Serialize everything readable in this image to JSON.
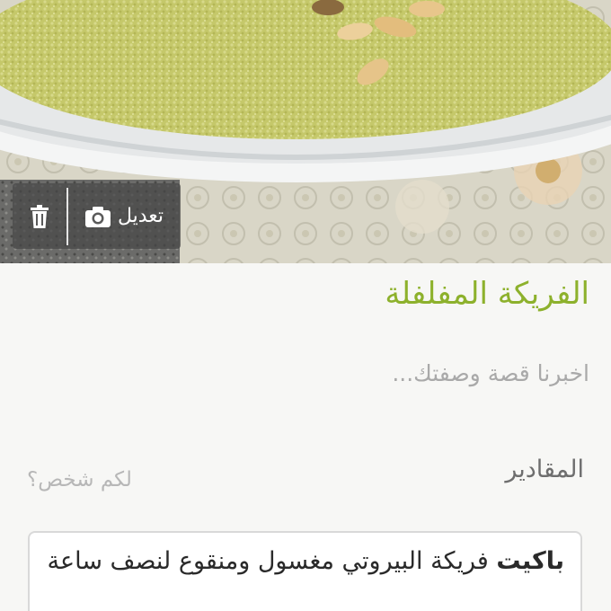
{
  "photo_toolbar": {
    "edit_label": "تعديل",
    "edit_icon": "camera-icon",
    "delete_icon": "trash-icon"
  },
  "recipe": {
    "title": "الفريكة المفلفلة",
    "story_placeholder": "اخبرنا قصة وصفتك...",
    "servings_label": "المقادير",
    "servings_placeholder": "لكم شخص؟",
    "ingredients": [
      {
        "quantity": "باكيت",
        "text": "فريكة البيروتي مغسول ومنقوع لنصف ساعة"
      }
    ]
  },
  "colors": {
    "title_green": "#8db12c",
    "placeholder_gray": "#a9a9a9",
    "background": "#f7f7f5"
  }
}
